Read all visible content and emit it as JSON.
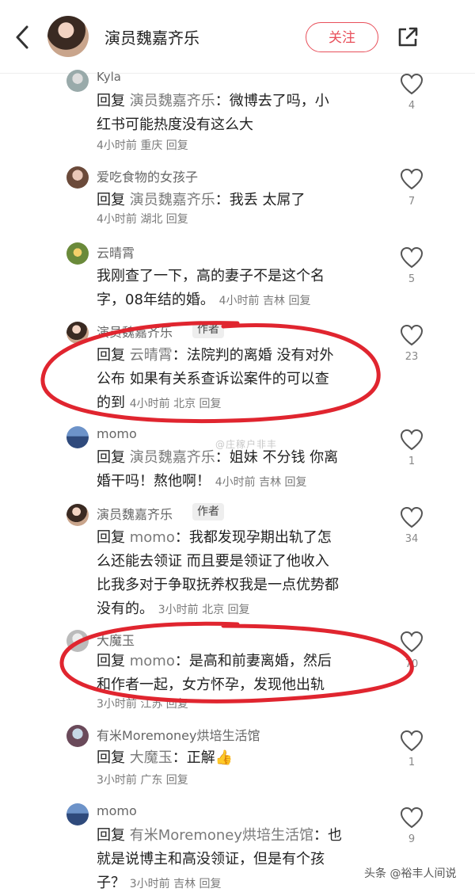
{
  "header": {
    "title": "演员魏嘉齐乐",
    "follow_label": "关注"
  },
  "comments": [
    {
      "name": "Kyla",
      "reply_label": "回复",
      "target": "演员魏嘉齐乐",
      "text_line1": "：微博去了吗，小",
      "text_line2": "红书可能热度没有这么大",
      "meta": "4小时前  重庆  回复",
      "likes": "4"
    },
    {
      "name": "爱吃食物的女孩子",
      "reply_label": "回复",
      "target": "演员魏嘉齐乐",
      "text_line1": "：我丢 太屌了",
      "meta": "4小时前  湖北  回复",
      "likes": "7"
    },
    {
      "name": "云晴霄",
      "text_line1": "我刚查了一下，高的妻子不是这个名",
      "text_line2": "字，08年结的婚。",
      "meta": "4小时前  吉林  回复",
      "likes": "5"
    },
    {
      "name": "演员魏嘉齐乐",
      "badge": "作者",
      "reply_label": "回复",
      "target": "云晴霄",
      "text_line1": "：法院判的离婚 没有对外",
      "text_line2": "公布 如果有关系查诉讼案件的可以查",
      "text_line3": "的到",
      "meta": "4小时前  北京  回复",
      "likes": "23"
    },
    {
      "name": "momo",
      "reply_label": "回复",
      "target": "演员魏嘉齐乐",
      "text_line1": "：姐妹 不分钱 你离",
      "text_line2": "婚干吗！熬他啊！",
      "meta": "4小时前  吉林  回复",
      "likes": "1"
    },
    {
      "name": "演员魏嘉齐乐",
      "badge": "作者",
      "reply_label": "回复",
      "target": "momo",
      "text_line1": "：我都发现孕期出轨了怎",
      "text_line2": "么还能去领证 而且要是领证了他收入",
      "text_line3": "比我多对于争取抚养权我是一点优势都",
      "text_line4": "没有的。",
      "meta": "3小时前  北京  回复",
      "likes": "34"
    },
    {
      "name": "大魔玉",
      "reply_label": "回复",
      "target": "momo",
      "text_line1": "：是高和前妻离婚，然后",
      "text_line2": "和作者一起，女方怀孕，发现他出轨",
      "meta": "3小时前  江苏  回复",
      "likes": "70"
    },
    {
      "name": "有米Moremoney烘培生活馆",
      "reply_label": "回复",
      "target": "大魔玉",
      "text_line1": "：正解",
      "emoji": "👍",
      "meta": "3小时前  广东  回复",
      "likes": "1"
    },
    {
      "name": "momo",
      "reply_label": "回复",
      "target": "有米Moremoney烘培生活馆",
      "text_line1": "：也",
      "text_line2": "就是说博主和高没领证，但是有个孩",
      "text_line3": "子？",
      "meta": "3小时前  吉林  回复",
      "likes": "9"
    }
  ],
  "watermarks": {
    "center": "@庄稼户非丰",
    "bottom_right": "头条 @裕丰人间说"
  },
  "colors": {
    "accent": "#e8505b",
    "annotation": "#e0252f"
  }
}
